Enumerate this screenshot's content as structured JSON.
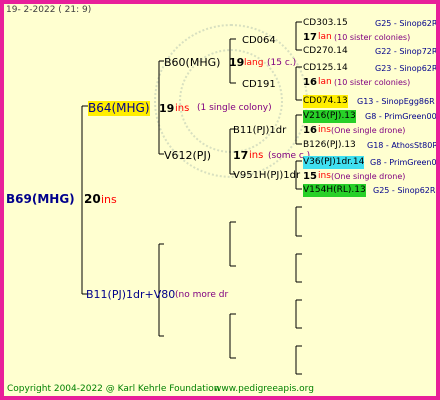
{
  "date": "19-  2-2022 ( 21:  9)",
  "root": {
    "name": "B69(MHG)",
    "ins_count": "20",
    "ins_label": "ins"
  },
  "gen1": {
    "mother": {
      "name": "B64(MHG)",
      "ins_count": "19",
      "ins_label": "ins",
      "note": "(1 single colony)"
    },
    "father": {
      "name": "B11(PJ)1dr+V80",
      "note": "(no more dr"
    }
  },
  "gen2": {
    "mm": {
      "name": "B60(MHG)",
      "ins_count": "19",
      "ins_label": "lang",
      "note": "(15 c.)"
    },
    "mf": {
      "name": "V612(PJ)",
      "ins_count": "17",
      "ins_label": "ins",
      "note": "(some c.)"
    }
  },
  "gen3": [
    {
      "name": "CD064"
    },
    {
      "name": "CD191"
    },
    {
      "name": "B11(PJ)1dr",
      "ins_count": "16",
      "ins_label": "ins",
      "note": "(One single drone)"
    },
    {
      "name": "V951H(PJ)1dr",
      "ins_count": "15",
      "ins_label": "ins",
      "note": "(One single drone)"
    }
  ],
  "gen4": [
    {
      "name": "CD303.15",
      "tag": "G25 - Sinop62R"
    },
    {
      "count": "17",
      "label": "lan",
      "note": "(10 sister colonies)"
    },
    {
      "name": "CD270.14",
      "tag": "G22 - Sinop72R"
    },
    {
      "name": "CD125.14",
      "tag": "G23 - Sinop62R"
    },
    {
      "count": "16",
      "label": "lan",
      "note": "(10 sister colonies)"
    },
    {
      "name": "CD074.13",
      "tag": "G13 - SinopEgg86R"
    },
    {
      "name": "V216(PJ).13",
      "tag": "G8 - PrimGreen00"
    },
    {
      "name": "B126(PJ).13",
      "tag": "G18 - AthosSt80R"
    },
    {
      "name": "V36(PJ)1dr.14",
      "tag": "G8 - PrimGreen00"
    },
    {
      "name": "V154H(RL).13",
      "tag": "G25 - Sinop62R"
    }
  ],
  "footer": {
    "copyright": "Copyright 2004-2022 @ Karl Kehrle Foundation",
    "url": "www.pedigreeapis.org"
  },
  "colors": {
    "border": "#e81f9a",
    "background": "#ffffd0",
    "name_text": "#00008b",
    "ins_text": "#ff0000",
    "note_text": "#800080",
    "footer_text": "#008000"
  }
}
